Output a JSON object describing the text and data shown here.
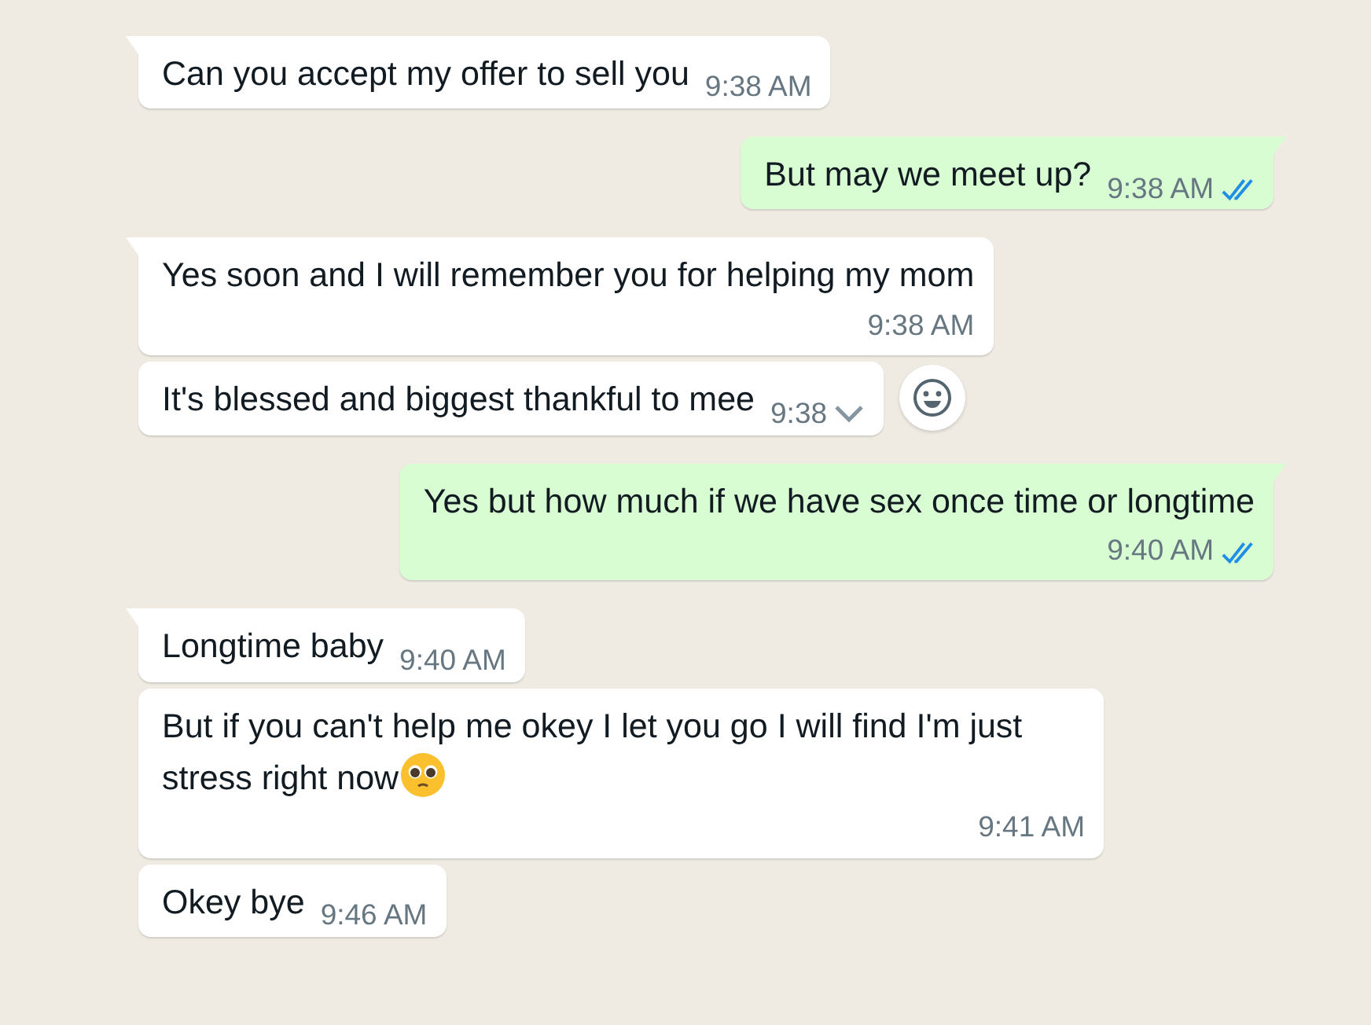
{
  "messages": [
    {
      "outgoing": false,
      "kind": "inline",
      "tail": true,
      "text": "Can you accept my offer to sell you",
      "time": "9:38 AM"
    },
    {
      "outgoing": true,
      "kind": "inline",
      "tail": true,
      "text": "But may we meet up?",
      "time": "9:38 AM",
      "read": true
    },
    {
      "outgoing": false,
      "kind": "stacked",
      "tail": true,
      "text": "Yes soon and I will remember you for helping my mom",
      "time": "9:38 AM"
    },
    {
      "outgoing": false,
      "kind": "inline",
      "tail": false,
      "text": "It's blessed and biggest thankful to mee",
      "time": "9:38",
      "hovered": true
    },
    {
      "outgoing": true,
      "kind": "stacked",
      "tail": true,
      "text": "Yes but how much if we have sex once time or longtime",
      "time": "9:40 AM",
      "read": true
    },
    {
      "outgoing": false,
      "kind": "inline",
      "tail": true,
      "text": "Longtime baby",
      "time": "9:40 AM"
    },
    {
      "outgoing": false,
      "kind": "stacked",
      "tail": false,
      "text": "But if you can't help me okey I let you go I will find I'm just stress right now",
      "time": "9:41 AM",
      "emoji": true
    },
    {
      "outgoing": false,
      "kind": "inline",
      "tail": false,
      "text": "Okey bye",
      "time": "9:46 AM"
    }
  ]
}
